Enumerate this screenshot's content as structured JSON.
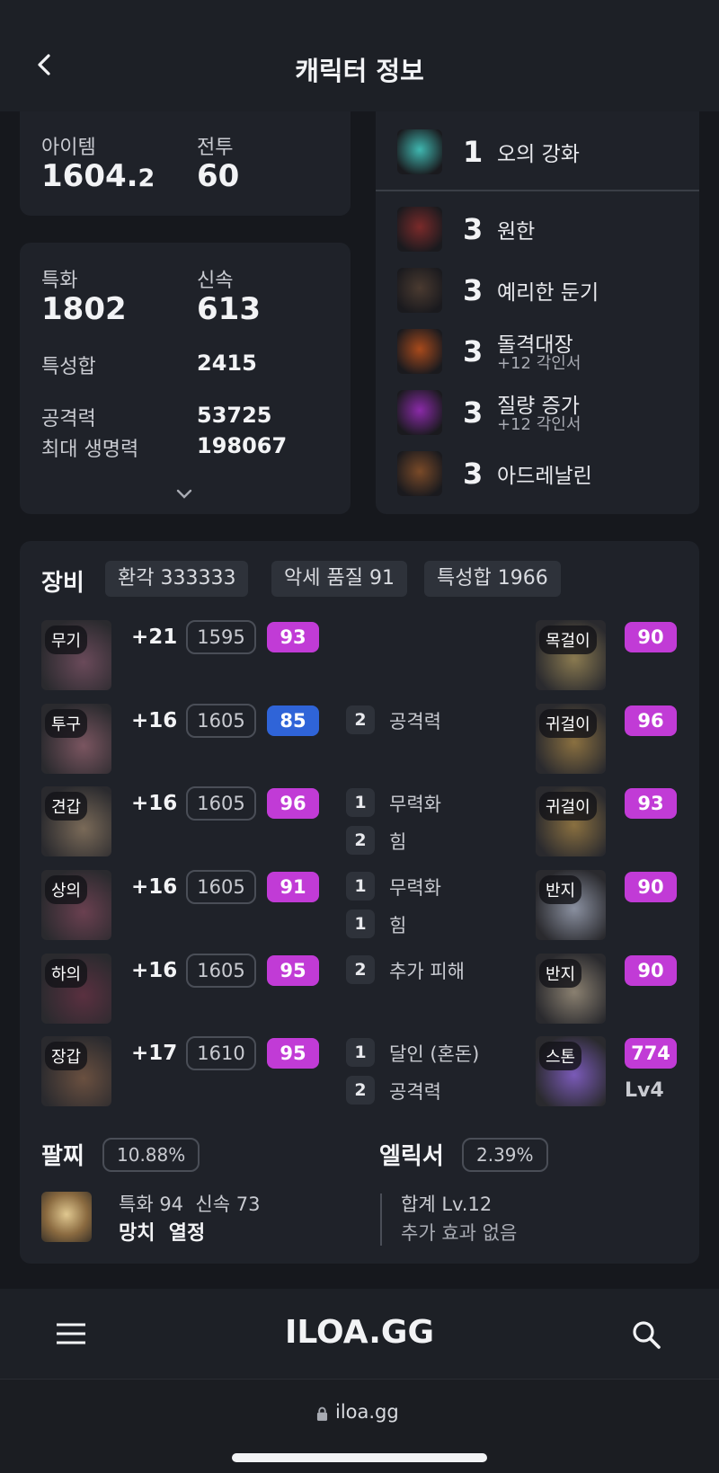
{
  "header": {
    "title": "캐릭터 정보"
  },
  "summary": {
    "item_label": "아이템",
    "item_value_main": "1604.",
    "item_value_frac": "2",
    "combat_label": "전투",
    "combat_value": "60"
  },
  "stats": {
    "crit_label": "특화",
    "crit_value": "1802",
    "swift_label": "신속",
    "swift_value": "613",
    "total_label": "특성합",
    "total_value": "2415",
    "atk_label": "공격력",
    "atk_value": "53725",
    "hp_label": "최대 생명력",
    "hp_value": "198067"
  },
  "engravings": [
    {
      "level": "1",
      "name": "오의 강화",
      "sub": "",
      "color": "#3fb7b0"
    },
    {
      "level": "3",
      "name": "원한",
      "sub": "",
      "color": "#7a2a2a"
    },
    {
      "level": "3",
      "name": "예리한 둔기",
      "sub": "",
      "color": "#4a3a30"
    },
    {
      "level": "3",
      "name": "돌격대장",
      "sub": "+12 각인서",
      "color": "#a84a1c"
    },
    {
      "level": "3",
      "name": "질량 증가",
      "sub": "+12 각인서",
      "color": "#8a2aa8"
    },
    {
      "level": "3",
      "name": "아드레날린",
      "sub": "",
      "color": "#7a4a28"
    }
  ],
  "equipment": {
    "title": "장비",
    "chips": [
      "환각 333333",
      "악세 품질 91",
      "특성합 1966"
    ],
    "items": [
      {
        "tag": "무기",
        "plus": "+21",
        "ilvl": "1595",
        "quality": "93",
        "qcolor": "#c13bd6",
        "color": "#6a4a5a"
      },
      {
        "tag": "투구",
        "plus": "+16",
        "ilvl": "1605",
        "quality": "85",
        "qcolor": "#2f64d8",
        "color": "#7a5560"
      },
      {
        "tag": "견갑",
        "plus": "+16",
        "ilvl": "1605",
        "quality": "96",
        "qcolor": "#c13bd6",
        "color": "#7a6a58"
      },
      {
        "tag": "상의",
        "plus": "+16",
        "ilvl": "1605",
        "quality": "91",
        "qcolor": "#c13bd6",
        "color": "#6a4050"
      },
      {
        "tag": "하의",
        "plus": "+16",
        "ilvl": "1605",
        "quality": "95",
        "qcolor": "#c13bd6",
        "color": "#5a3040"
      },
      {
        "tag": "장갑",
        "plus": "+17",
        "ilvl": "1610",
        "quality": "95",
        "qcolor": "#c13bd6",
        "color": "#6a5040"
      }
    ],
    "effects": [
      [],
      [
        {
          "n": "2",
          "t": "공격력"
        }
      ],
      [
        {
          "n": "1",
          "t": "무력화"
        },
        {
          "n": "2",
          "t": "힘"
        }
      ],
      [
        {
          "n": "1",
          "t": "무력화"
        },
        {
          "n": "1",
          "t": "힘"
        }
      ],
      [
        {
          "n": "2",
          "t": "추가 피해"
        }
      ],
      [
        {
          "n": "1",
          "t": "달인 (혼돈)"
        },
        {
          "n": "2",
          "t": "공격력"
        }
      ]
    ],
    "accessories": [
      {
        "tag": "목걸이",
        "quality": "90",
        "color": "#8a7a50"
      },
      {
        "tag": "귀걸이",
        "quality": "96",
        "color": "#8a7040"
      },
      {
        "tag": "귀걸이",
        "quality": "93",
        "color": "#8a7040"
      },
      {
        "tag": "반지",
        "quality": "90",
        "color": "#8a90a0"
      },
      {
        "tag": "반지",
        "quality": "90",
        "color": "#8a8070"
      },
      {
        "tag": "스톤",
        "quality": "774",
        "color": "#7a5ab8",
        "extra": "Lv4"
      }
    ]
  },
  "bracelet": {
    "title": "팔찌",
    "percent": "10.88%",
    "stats": "특화 94  신속 73",
    "effects": "망치  열정"
  },
  "elixir": {
    "title": "엘릭서",
    "percent": "2.39%",
    "total": "합계 Lv.12",
    "effect": "추가 효과 없음"
  },
  "footer": {
    "logo": "ILOA.GG"
  },
  "browser": {
    "url": "iloa.gg"
  }
}
